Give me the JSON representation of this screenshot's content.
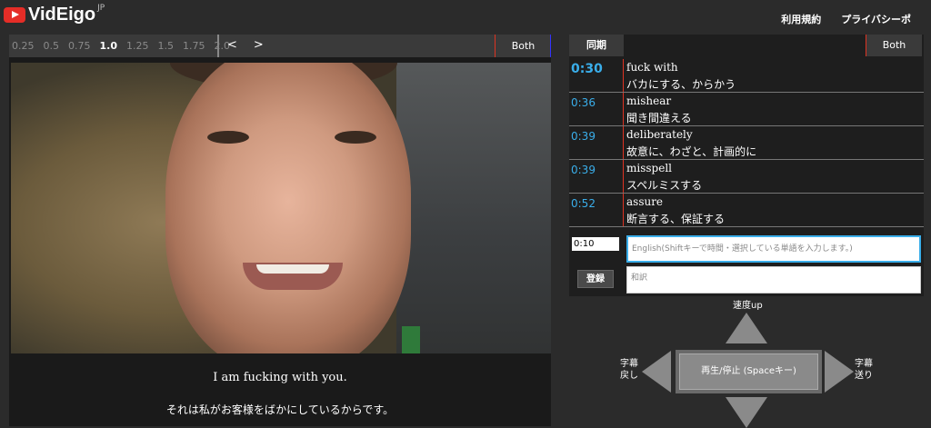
{
  "header": {
    "logo_text": "VidEigo",
    "logo_suffix": "JP",
    "nav": [
      "利用規約",
      "プライバシーポ"
    ]
  },
  "player": {
    "speeds": [
      "0.25",
      "0.5",
      "0.75",
      "1.0",
      "1.25",
      "1.5",
      "1.75",
      "2.0"
    ],
    "active_speed": "1.0",
    "prev_label": "<",
    "next_label": ">",
    "mode_label": "Both",
    "subtitle_en": "I am fucking with you.",
    "subtitle_ja": "それは私がお客様をばかにしているからです。"
  },
  "wordlist": {
    "sync_label": "同期",
    "mode_label": "Both",
    "items": [
      {
        "time": "0:30",
        "en": "fuck  with",
        "ja": "バカにする、からかう"
      },
      {
        "time": "0:36",
        "en": "mishear",
        "ja": "聞き間違える"
      },
      {
        "time": "0:39",
        "en": "deliberately",
        "ja": "故意に、わざと、計画的に"
      },
      {
        "time": "0:39",
        "en": "misspell",
        "ja": "スペルミスする"
      },
      {
        "time": "0:52",
        "en": "assure",
        "ja": "断言する、保証する"
      }
    ]
  },
  "entry": {
    "time_value": "0:10",
    "english_placeholder": "English(Shiftキーで時間・選択している単語を入力します。)",
    "japanese_placeholder": "和訳",
    "register_label": "登録"
  },
  "controls": {
    "speed_up": "速度up",
    "prev_sub_1": "字幕",
    "prev_sub_2": "戻し",
    "next_sub_1": "字幕",
    "next_sub_2": "送り",
    "play_label": "再生/停止 (Spaceキー)"
  },
  "colors": {
    "accent_blue": "#3aaeea",
    "accent_red": "#dd3322",
    "logo_red": "#e52d27"
  }
}
